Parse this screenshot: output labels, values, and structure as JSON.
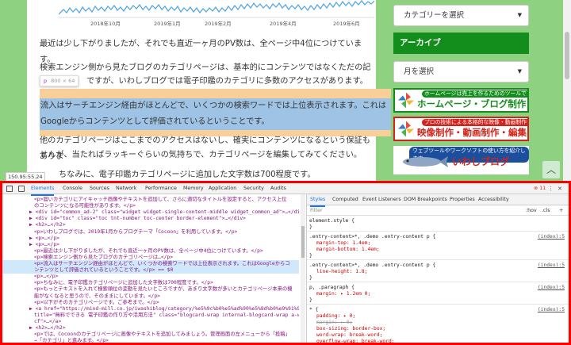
{
  "chart": {
    "xticks": [
      "2018年10月",
      "2019年1月",
      "2019年2月",
      "2019年4月",
      "2019年6月"
    ]
  },
  "article": {
    "p1": "最近は少し下がりましたが、それでも直近一ヶ月のPV数は、全ページ中4位につけています。",
    "p2a": "検索エンジン側から見たブログのカテゴリページは、基本的にコンテンツではなくただの記事一覧",
    "p2b": "ですが、いわしブログでは電子印鑑のカテゴリに多数のアクセスがあります。",
    "hl1": "流入はサーチエンジン経由がほとんどで、いくつかの検索ワードでは上位表示されます。これは",
    "hl2": "Googleからコンテンツとして評価されているということです。",
    "p3a": "他のカテゴリページはここまでのアクセスはないし、確実にコンテンツになるという保証もありま",
    "p3b": "せんが、当たればラッキーぐらいの気持ちで、カテゴリページを編集してみてください。",
    "p4": "ちなみに、電子印鑑カテゴリページに追加した文字数は700程度です。",
    "tip_tag": "p",
    "tip_size": "800 × 64",
    "coord": "150.95:55.24"
  },
  "sidebar": {
    "category_select": "カテゴリーを選択",
    "archive_label": "アーカイブ",
    "month_select": "月を選択",
    "banner1_small": "ホームページは売上を作るためのツールです",
    "banner1_big": "ホームページ・ブログ制作",
    "banner2_small": "プロの技術による本格的な映像・動画制作を",
    "banner2_big": "映像制作・動画制作・編集",
    "banner3_small": "ウェブツールやワークソフトの使い方を紹介します",
    "banner3_big": "いわしブログ",
    "colors": {
      "green": "#138d1b",
      "blue": "#1c4e9e",
      "red": "#d0241c"
    }
  },
  "devtools": {
    "tabs": [
      "Elements",
      "Console",
      "Sources",
      "Network",
      "Performance",
      "Memory",
      "Application",
      "Security",
      "Audits"
    ],
    "error_count": "11",
    "elements_lines": [
      "<p>届いカテゴリにアイキャッチ画像やテキストを追加して、さらに適切なタイトルを設定すると、アクセス上位",
      "のコンテンツになる可能性があります。</p>",
      "▶ <div id=\"common_ad-2\" class=\"widget widget-single-content-middle widget_common_ad\">…</div>",
      "▶ <div id=\"toc\" class=\"toc tnt-number toc-center border-element\">…</div>",
      "▶ <h2>…</h2>",
      "<p>いわしブログでは、2019年1月からブログテーマ「Cocoon」を利用しています。</p>",
      "▶ <p>…</p>",
      "▶ <p>…</p>",
      "<p>最近は少し下がりましたが、それでも直近一ヶ月のPV数は、全ページ中4位につけています。</p>",
      "<p>検索エンジン側から見たブログのカテゴリページは…</p>",
      "<p>流入はサーチエンジン経由がほとんどで、いくつかの検索ワードでは上位表示されます。これはGoogleからコ",
      "ンテンツとして評価されているということです。</p> == $0",
      "<p>…</p>",
      "<p>ちなみに、電子印鑑カテゴリページに追加した文字数は700程度です。</p>",
      "<p>もっとテキストを入れて検索順位の変動を見たいところですが、あまり文字数が多いとカテゴリページ本来の機",
      "能がなくなると思うので、そのままにしています。</p>",
      "<p>以下がそのカテゴリページです。ご参考まで。</p>",
      "▶ <a href=\"https://mind-mill.co.jp/iwashiblog/category/%e5%9c%b0%e5%ad%90%e5%8d%b0%e9%91%91/\"",
      "title=\"無料でできる 電子印鑑の作り方や活用方法\" class=\"blogcard-wrap internal-blogcard-wrap a-wrap",
      "cf\">…</a>",
      "▶ <h2>…</h2>",
      "<p>では、Cocoonのカテゴリページに画像やテキストを追加してみましょう。管理画面の左メニューから「投稿」",
      "→「カテゴリ」と進みます。</p>"
    ],
    "styles_tabs": [
      "Styles",
      "Computed",
      "Event Listeners",
      "DOM Breakpoints",
      "Properties",
      "Accessibility"
    ],
    "filter_placeholder": "Filter",
    "filter_hov": ":hov",
    "filter_cls": ".cls",
    "filter_plus": "+",
    "rules": [
      {
        "selector": "element.style {",
        "props": [],
        "link": ""
      },
      {
        "selector": ".entry-content>*, .demo .entry-content p {",
        "props": [
          "margin-top: 1.4em;",
          "margin-bottom: 1.4em;"
        ],
        "link": "(index):5"
      },
      {
        "selector": ".entry-content>*, .demo .entry-content p {",
        "props": [
          "line-height: 1.8;"
        ],
        "link": "(index):5"
      },
      {
        "selector": "p, .paragraph {",
        "props": [
          "margin: ▸ 1.2em 0;"
        ],
        "link": "(index):5"
      },
      {
        "selector": "* {",
        "props": [
          "padding: ▸ 0;",
          "margin: ▸ 0;",
          "box-sizing: border-box;",
          "word-wrap: break-word;",
          "overflow-wrap: break-word;"
        ],
        "link": "(index):5"
      }
    ]
  }
}
